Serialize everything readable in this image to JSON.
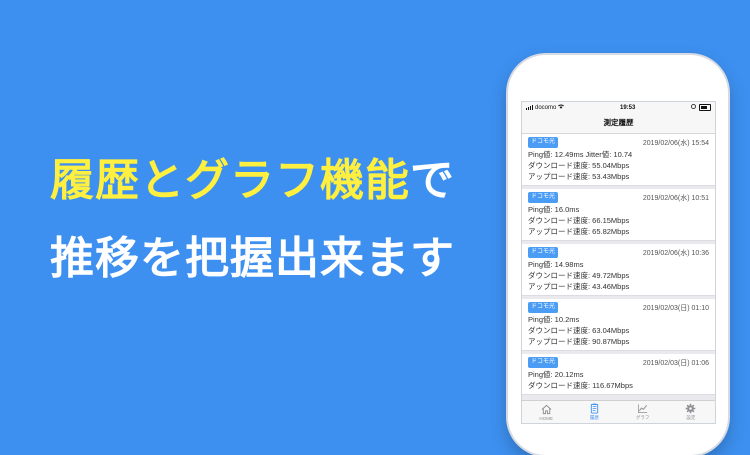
{
  "headline": {
    "line1_highlight": "履歴とグラフ機能",
    "line1_suffix": "で",
    "line2": "推移を把握出来ます"
  },
  "status_bar": {
    "carrier": "docomo",
    "time": "19:53"
  },
  "nav": {
    "title": "測定履歴"
  },
  "entries": [
    {
      "badge": "ドコモ光",
      "date": "2019/02/06(水) 15:54",
      "line1": "Ping値: 12.49ms Jitter値: 10.74",
      "line2": "ダウンロード速度: 55.04Mbps",
      "line3": "アップロード速度: 53.43Mbps"
    },
    {
      "badge": "ドコモ光",
      "date": "2019/02/06(水) 10:51",
      "line1": "Ping値: 16.0ms",
      "line2": "ダウンロード速度: 66.15Mbps",
      "line3": "アップロード速度: 65.82Mbps"
    },
    {
      "badge": "ドコモ光",
      "date": "2019/02/06(水) 10:36",
      "line1": "Ping値: 14.98ms",
      "line2": "ダウンロード速度: 49.72Mbps",
      "line3": "アップロード速度: 43.46Mbps"
    },
    {
      "badge": "ドコモ光",
      "date": "2019/02/03(日) 01:10",
      "line1": "Ping値: 10.2ms",
      "line2": "ダウンロード速度: 63.04Mbps",
      "line3": "アップロード速度: 90.87Mbps"
    },
    {
      "badge": "ドコモ光",
      "date": "2019/02/03(日) 01:06",
      "line1": "Ping値: 20.12ms",
      "line2": "ダウンロード速度: 116.67Mbps",
      "line3": ""
    }
  ],
  "tabs": [
    {
      "label": "HOME",
      "icon": "home-icon"
    },
    {
      "label": "履歴",
      "icon": "history-icon"
    },
    {
      "label": "グラフ",
      "icon": "graph-icon"
    },
    {
      "label": "設定",
      "icon": "gear-icon"
    }
  ],
  "colors": {
    "background": "#3d90f0",
    "highlight": "#ffef3f",
    "badge": "#4a9cf4"
  }
}
